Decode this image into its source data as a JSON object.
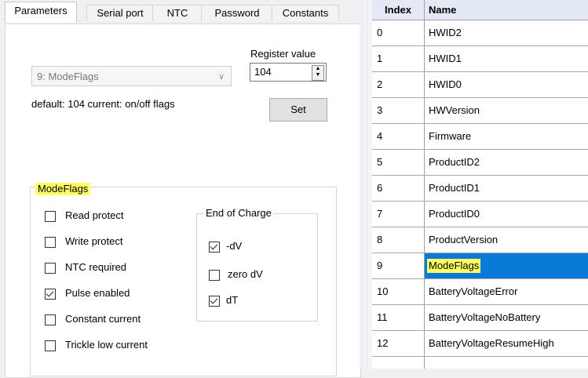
{
  "tabs": [
    {
      "label": "Parameters",
      "active": true
    },
    {
      "label": "Serial port",
      "active": false
    },
    {
      "label": "NTC",
      "active": false
    },
    {
      "label": "Password",
      "active": false
    },
    {
      "label": "Constants",
      "active": false
    }
  ],
  "parameter_select": {
    "value": "9: ModeFlags"
  },
  "register": {
    "label": "Register value",
    "value": "104"
  },
  "default_text": "default: 104 current: on/off flags",
  "set_button": "Set",
  "modeflags": {
    "title": "ModeFlags",
    "options": [
      {
        "label": "Read protect",
        "checked": false
      },
      {
        "label": "Write protect",
        "checked": false
      },
      {
        "label": "NTC required",
        "checked": false
      },
      {
        "label": "Pulse enabled",
        "checked": true
      },
      {
        "label": "Constant current",
        "checked": false
      },
      {
        "label": "Trickle low current",
        "checked": false
      }
    ]
  },
  "end_of_charge": {
    "title": "End of Charge",
    "options": [
      {
        "label": "-dV",
        "checked": true
      },
      {
        "label": "zero dV",
        "checked": false
      },
      {
        "label": "dT",
        "checked": true
      }
    ]
  },
  "register_table": {
    "columns": [
      "Index",
      "Name"
    ],
    "rows": [
      {
        "index": "0",
        "name": "HWID2"
      },
      {
        "index": "1",
        "name": "HWID1"
      },
      {
        "index": "2",
        "name": "HWID0"
      },
      {
        "index": "3",
        "name": "HWVersion"
      },
      {
        "index": "4",
        "name": "Firmware"
      },
      {
        "index": "5",
        "name": "ProductID2"
      },
      {
        "index": "6",
        "name": "ProductID1"
      },
      {
        "index": "7",
        "name": "ProductID0"
      },
      {
        "index": "8",
        "name": "ProductVersion"
      },
      {
        "index": "9",
        "name": "ModeFlags",
        "selected": true
      },
      {
        "index": "10",
        "name": "BatteryVoltageError"
      },
      {
        "index": "11",
        "name": "BatteryVoltageNoBattery"
      },
      {
        "index": "12",
        "name": "BatteryVoltageResumeHigh"
      }
    ]
  },
  "colors": {
    "highlight": "#ffff66",
    "selection": "#0a7ad8",
    "header_bg": "#e3eaf5"
  }
}
